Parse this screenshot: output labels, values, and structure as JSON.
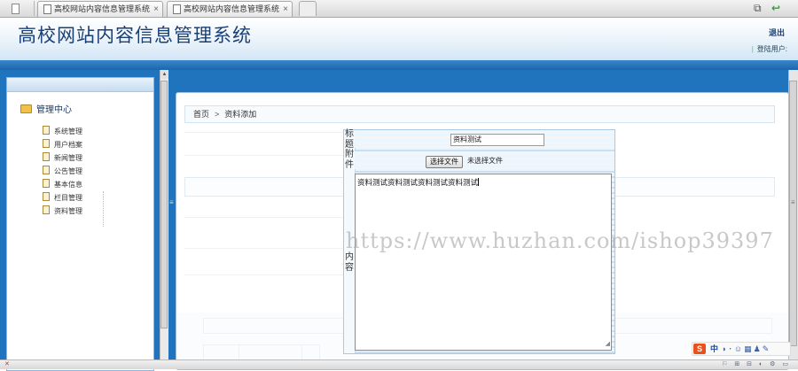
{
  "browser": {
    "tabs": [
      {
        "label": "高校网站内容信息管理系统",
        "close": "×"
      },
      {
        "label": "高校网站内容信息管理系统",
        "close": "×"
      }
    ],
    "back_icon": "↩"
  },
  "header": {
    "title": "高校网站内容信息管理系统",
    "logout_label": "退出",
    "login_user_label": "登陆用户:"
  },
  "sidebar": {
    "root_label": "管理中心",
    "items": [
      {
        "label": "系统管理"
      },
      {
        "label": "用户档案"
      },
      {
        "label": "新闻管理"
      },
      {
        "label": "公告管理"
      },
      {
        "label": "基本信息"
      },
      {
        "label": "栏目管理"
      },
      {
        "label": "资料管理"
      }
    ]
  },
  "breadcrumb": {
    "home": "首页",
    "separator": ">",
    "current": "资料添加"
  },
  "form": {
    "title_label": "标题",
    "title_value": "资料测试",
    "attachment_label": "附件",
    "file_button": "选择文件",
    "file_status": "未选择文件",
    "content_label": "内容",
    "content_value": "资料测试资料测试资料测试资料测试"
  },
  "watermark": "https://www.huzhan.com/ishop39397",
  "ime": {
    "logo": "S",
    "mode": "中"
  },
  "colors": {
    "frame_blue": "#1f74bd",
    "title_text": "#1a3f73",
    "panel_border": "#a9c8e4"
  }
}
